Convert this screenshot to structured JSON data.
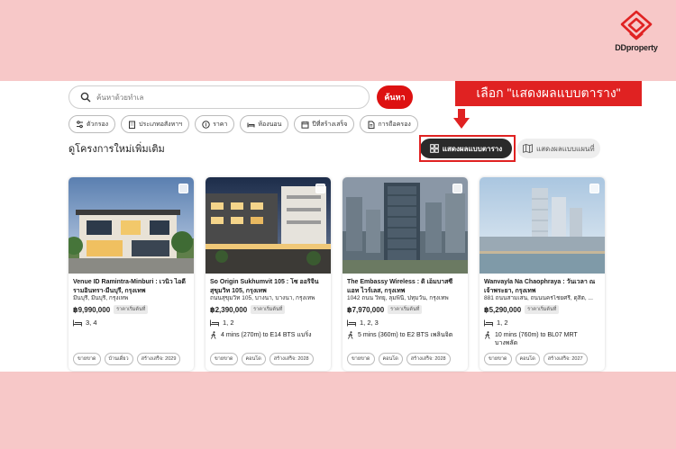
{
  "brand": {
    "name": "DDproperty",
    "accent": "#e02222"
  },
  "search": {
    "placeholder": "ค้นหาด้วยทำเล",
    "button_label": "ค้นหา"
  },
  "callout": {
    "text": "เลือก \"แสดงผลแบบตาราง\""
  },
  "filters": [
    {
      "label": "ตัวกรอง",
      "icon": "filter-icon"
    },
    {
      "label": "ประเภทอสังหาฯ",
      "icon": "building-icon"
    },
    {
      "label": "ราคา",
      "icon": "coin-icon"
    },
    {
      "label": "ห้องนอน",
      "icon": "bed-icon"
    },
    {
      "label": "ปีที่สร้างเสร็จ",
      "icon": "calendar-icon"
    },
    {
      "label": "การถือครอง",
      "icon": "document-icon"
    }
  ],
  "section_title": "ดูโครงการใหม่เพิ่มเติม",
  "view": {
    "grid_label": "แสดงผลแบบตาราง",
    "map_label": "แสดงผลแบบแผนที่",
    "selected": "grid"
  },
  "listings": [
    {
      "name": "Venue ID Ramintra-Minburi : เวนิว ไอดี รามอินทรา-มีนบุรี, กรุงเทพ",
      "address": "มีนบุรี, มีนบุรี, กรุงเทพ",
      "price": "฿9,990,000",
      "price_badge": "ราคาเริ่มต้นที่",
      "bedrooms": "3, 4",
      "transit": "",
      "tags": [
        "ขายขาด",
        "บ้านเดี่ยว",
        "สร้างเสร็จ: 2029"
      ]
    },
    {
      "name": "So Origin Sukhumvit 105 : โซ ออริจิ้น สุขุมวิท 105, กรุงเทพ",
      "address": "ถนนสุขุมวิท 105, บางนา, บางนา, กรุงเทพ",
      "price": "฿2,390,000",
      "price_badge": "ราคาเริ่มต้นที่",
      "bedrooms": "1, 2",
      "transit": "4 mins (270m) to E14 BTS แบริ่ง",
      "tags": [
        "ขายขาด",
        "คอนโด",
        "สร้างเสร็จ: 2028"
      ]
    },
    {
      "name": "The Embassy Wireless : ดิ เอ็มบาสซี แอท ไวร์เลส, กรุงเทพ",
      "address": "1042 ถนน วิทยุ, ลุมพินี, ปทุมวัน, กรุงเทพ",
      "price": "฿7,970,000",
      "price_badge": "ราคาเริ่มต้นที่",
      "bedrooms": "1, 2, 3",
      "transit": "5 mins (360m) to E2 BTS เพลินจิต",
      "tags": [
        "ขายขาด",
        "คอนโด",
        "สร้างเสร็จ: 2028"
      ]
    },
    {
      "name": "Wanvayla Na Chaophraya : วันเวลา ณ เจ้าพระยา, กรุงเทพ",
      "address": "881 ถนนสามเสน, ถนนนครไชยศรี, ดุสิต, ...",
      "price": "฿5,290,000",
      "price_badge": "ราคาเริ่มต้นที่",
      "bedrooms": "1, 2",
      "transit": "10 mins (760m) to BL07 MRT บางพลัด",
      "tags": [
        "ขายขาด",
        "คอนโด",
        "สร้างเสร็จ: 2027"
      ]
    }
  ]
}
